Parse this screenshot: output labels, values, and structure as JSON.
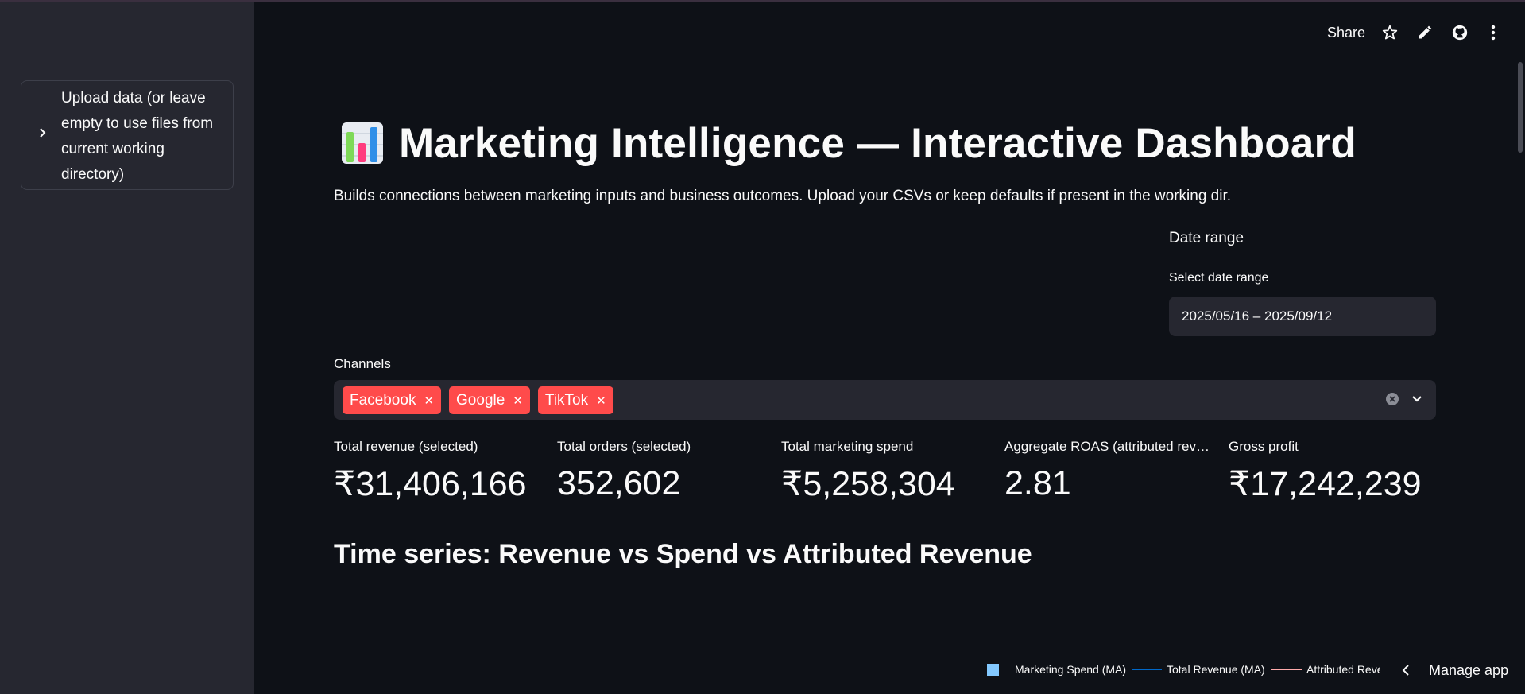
{
  "sidebar": {
    "upload_expander_label": "Upload data (or leave empty to use files from current working directory)"
  },
  "toolbar": {
    "share_label": "Share"
  },
  "header": {
    "title": "Marketing Intelligence — Interactive Dashboard",
    "subtitle": "Builds connections between marketing inputs and business outcomes. Upload your CSVs or keep defaults if present in the working dir."
  },
  "date_filter": {
    "section_label": "Date range",
    "input_label": "Select date range",
    "value": "2025/05/16 – 2025/09/12"
  },
  "channels": {
    "label": "Channels",
    "selected": [
      "Facebook",
      "Google",
      "TikTok"
    ]
  },
  "metrics": [
    {
      "label": "Total revenue (selected)",
      "value": "₹31,406,166"
    },
    {
      "label": "Total orders (selected)",
      "value": "352,602"
    },
    {
      "label": "Total marketing spend",
      "value": "₹5,258,304"
    },
    {
      "label": "Aggregate ROAS (attributed revenue / spend)",
      "value": "2.81"
    },
    {
      "label": "Gross profit",
      "value": "₹17,242,239"
    }
  ],
  "section": {
    "timeseries_title": "Time series: Revenue vs Spend vs Attributed Revenue"
  },
  "legend": [
    {
      "label": "Marketing Spend (MA)",
      "color": "#83c9ff"
    },
    {
      "label": "Total Revenue (MA)",
      "color": "#0068c9"
    },
    {
      "label": "Attributed Revenue (MA)",
      "color": "#ffabab"
    }
  ],
  "footer": {
    "manage_app_label": "Manage app"
  },
  "colors": {
    "background": "#0e1117",
    "sidebar": "#262730",
    "accent_tag": "#ff4b4b"
  }
}
